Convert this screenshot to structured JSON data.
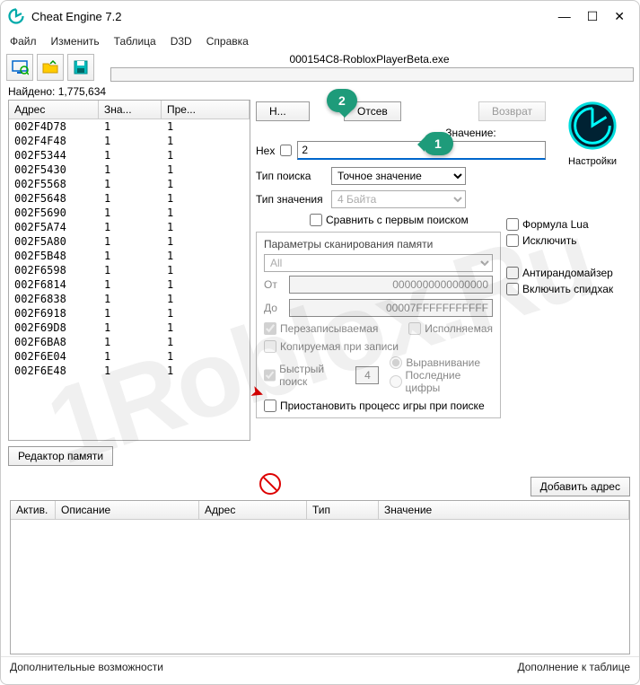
{
  "window": {
    "title": "Cheat Engine 7.2",
    "min": "—",
    "max": "☐",
    "close": "✕"
  },
  "menu": {
    "file": "Файл",
    "edit": "Изменить",
    "table": "Таблица",
    "d3d": "D3D",
    "help": "Справка"
  },
  "process_label": "000154C8-RobloxPlayerBeta.exe",
  "found_label": "Найдено: 1,775,634",
  "results_header": {
    "addr": "Адрес",
    "val": "Зна...",
    "prev": "Пре..."
  },
  "results": [
    {
      "a": "002F4D78",
      "v": "1",
      "p": "1"
    },
    {
      "a": "002F4F48",
      "v": "1",
      "p": "1"
    },
    {
      "a": "002F5344",
      "v": "1",
      "p": "1"
    },
    {
      "a": "002F5430",
      "v": "1",
      "p": "1"
    },
    {
      "a": "002F5568",
      "v": "1",
      "p": "1"
    },
    {
      "a": "002F5648",
      "v": "1",
      "p": "1"
    },
    {
      "a": "002F5690",
      "v": "1",
      "p": "1"
    },
    {
      "a": "002F5A74",
      "v": "1",
      "p": "1"
    },
    {
      "a": "002F5A80",
      "v": "1",
      "p": "1"
    },
    {
      "a": "002F5B48",
      "v": "1",
      "p": "1"
    },
    {
      "a": "002F6598",
      "v": "1",
      "p": "1"
    },
    {
      "a": "002F6814",
      "v": "1",
      "p": "1"
    },
    {
      "a": "002F6838",
      "v": "1",
      "p": "1"
    },
    {
      "a": "002F6918",
      "v": "1",
      "p": "1"
    },
    {
      "a": "002F69D8",
      "v": "1",
      "p": "1"
    },
    {
      "a": "002F6BA8",
      "v": "1",
      "p": "1"
    },
    {
      "a": "002F6E04",
      "v": "1",
      "p": "1"
    },
    {
      "a": "002F6E48",
      "v": "1",
      "p": "1"
    }
  ],
  "memory_editor_btn": "Редактор памяти",
  "scan": {
    "new": "Н...",
    "next": "Отсев",
    "undo": "Возврат",
    "value_label": "Значение:",
    "hex_label": "Hex",
    "value_input": "2",
    "scan_type_label": "Тип поиска",
    "scan_type_value": "Точное значение",
    "value_type_label": "Тип значения",
    "value_type_value": "4 Байта",
    "lua": "Формула Lua",
    "not": "Исключить",
    "compare_first": "Сравнить с первым поиском",
    "params_legend": "Параметры сканирования памяти",
    "region": "All",
    "from_label": "От",
    "from_value": "0000000000000000",
    "to_label": "До",
    "to_value": "00007FFFFFFFFFFF",
    "writable": "Перезаписываемая",
    "executable": "Исполняемая",
    "cow": "Копируемая при записи",
    "fast": "Быстрый поиск",
    "align_value": "4",
    "alignment": "Выравнивание",
    "last_digits": "Последние цифры",
    "pause": "Приостановить процесс игры при поиске",
    "unrandom": "Антирандомайзер",
    "speedhack": "Включить спидхак"
  },
  "settings_label": "Настройки",
  "add_addr": "Добавить адрес",
  "addrlist_header": {
    "active": "Актив.",
    "desc": "Описание",
    "addr": "Адрес",
    "type": "Тип",
    "val": "Значение"
  },
  "footer": {
    "left": "Дополнительные возможности",
    "right": "Дополнение к таблице"
  },
  "callouts": {
    "one": "1",
    "two": "2"
  },
  "watermark": "1Roblox.Ru"
}
